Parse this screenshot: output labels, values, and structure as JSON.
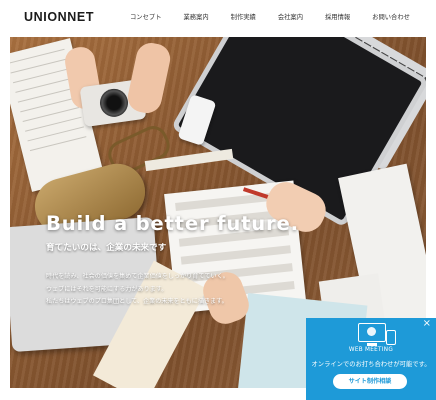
{
  "header": {
    "logo": "UNIONNET",
    "nav": [
      "コンセプト",
      "業務案内",
      "制作実績",
      "会社案内",
      "採用情報",
      "お問い合わせ"
    ]
  },
  "hero": {
    "tagline": "Build a better future.",
    "subtagline": "育てたいのは、企業の未来です",
    "description": [
      "時代を読み、社会の価値を集めて企業価値をしっかり育てていく。",
      "ウェブにはそれを可能にする力があります。",
      "私たちはウェブのプロ集団として、企業の未来をともに描きます。"
    ]
  },
  "web_meeting": {
    "close": "×",
    "label": "WEB MEETING",
    "text": "オンラインでのお打ち合わせが可能です。",
    "button": "サイト制作相談"
  },
  "colors": {
    "accent": "#1e9ad8",
    "logo": "#1b1b1b"
  }
}
